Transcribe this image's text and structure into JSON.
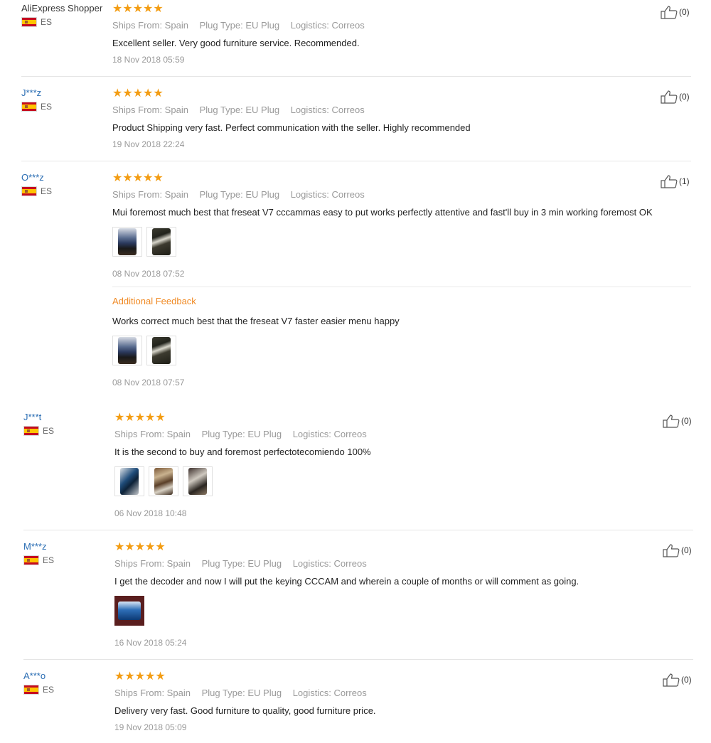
{
  "reviews": [
    {
      "user": "AliExpress Shopper",
      "country": "ES",
      "stars": "★★★★★",
      "ships_from": "Ships From: Spain",
      "plug_type": "Plug Type: EU Plug",
      "logistics": "Logistics: Correos",
      "text": "Excellent seller. Very good furniture service. Recommended.",
      "date": "18 Nov 2018 05:59",
      "likes": "(0)"
    },
    {
      "user": "J***z",
      "country": "ES",
      "stars": "★★★★★",
      "ships_from": "Ships From: Spain",
      "plug_type": "Plug Type: EU Plug",
      "logistics": "Logistics: Correos",
      "text": "Product Shipping very fast. Perfect communication with the seller. Highly recommended",
      "date": "19 Nov 2018 22:24",
      "likes": "(0)"
    },
    {
      "user": "O***z",
      "country": "ES",
      "stars": "★★★★★",
      "ships_from": "Ships From: Spain",
      "plug_type": "Plug Type: EU Plug",
      "logistics": "Logistics: Correos",
      "text": "Mui foremost much best that freseat V7 cccammas easy to put works perfectly attentive and fast'll buy in 3 min working foremost OK",
      "date": "08 Nov 2018 07:52",
      "likes": "(1)",
      "additional": {
        "title": "Additional Feedback",
        "text": "Works correct much best that the freseat V7 faster easier menu happy",
        "date": "08 Nov 2018 07:57"
      }
    },
    {
      "user": "J***t",
      "country": "ES",
      "stars": "★★★★★",
      "ships_from": "Ships From: Spain",
      "plug_type": "Plug Type: EU Plug",
      "logistics": "Logistics: Correos",
      "text": "It is the second to buy and foremost perfectotecomiendo 100%",
      "date": "06 Nov 2018 10:48",
      "likes": "(0)"
    },
    {
      "user": "M***z",
      "country": "ES",
      "stars": "★★★★★",
      "ships_from": "Ships From: Spain",
      "plug_type": "Plug Type: EU Plug",
      "logistics": "Logistics: Correos",
      "text": "I get the decoder and now I will put the keying CCCAM and wherein a couple of months or will comment as going.",
      "date": "16 Nov 2018 05:24",
      "likes": "(0)"
    },
    {
      "user": "A***o",
      "country": "ES",
      "stars": "★★★★★",
      "ships_from": "Ships From: Spain",
      "plug_type": "Plug Type: EU Plug",
      "logistics": "Logistics: Correos",
      "text": "Delivery very fast. Good furniture to quality, good furniture price.",
      "date": "19 Nov 2018 05:09",
      "likes": "(0)"
    }
  ],
  "colors": {
    "star": "#f39c12",
    "link": "#2a6db3",
    "additional_title": "#f08a24",
    "meta": "#999999"
  }
}
